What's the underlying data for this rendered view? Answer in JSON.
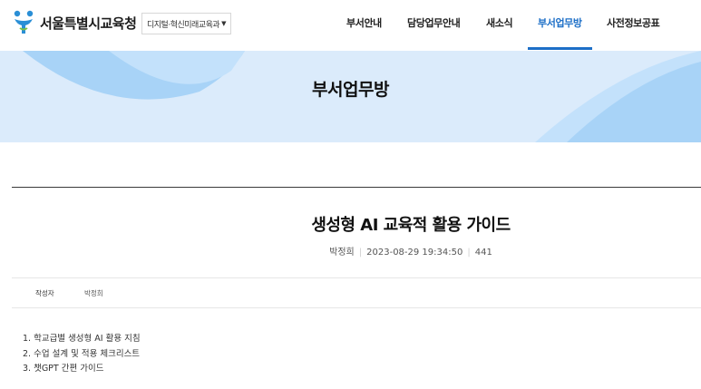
{
  "header": {
    "org_name": "서울특별시교육청",
    "department": "디지털·혁신미래교육과",
    "nav": [
      {
        "label": "부서안내",
        "active": false
      },
      {
        "label": "담당업무안내",
        "active": false
      },
      {
        "label": "새소식",
        "active": false
      },
      {
        "label": "부서업무방",
        "active": true
      },
      {
        "label": "사전정보공표",
        "active": false
      }
    ]
  },
  "banner": {
    "title": "부서업무방"
  },
  "post": {
    "title": "생성형 AI 교육적 활용 가이드",
    "author": "박정희",
    "date": "2023-08-29 19:34:50",
    "views": "441",
    "author_label": "작성자",
    "author_value": "박정희",
    "content": [
      "1. 학교급별 생성형 AI 활용 지침",
      "2. 수업 설계 및 적용 체크리스트",
      "3. 챗GPT 간편 가이드"
    ]
  },
  "colors": {
    "accent": "#1d6fc7",
    "banner_bg": "#dbebfb",
    "banner_shape": "#a8d3f7"
  },
  "icons": {
    "logo": "seoul-education-logo-icon",
    "caret": "caret-down-icon"
  }
}
